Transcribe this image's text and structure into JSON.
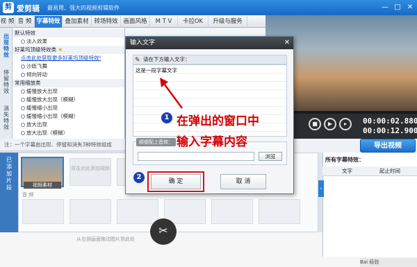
{
  "app": {
    "name": "爱剪辑",
    "slogan": "最易用、强大的视频剪辑软件",
    "window_buttons": [
      "—",
      "□",
      "✕"
    ]
  },
  "tabs": [
    {
      "label": "视 频"
    },
    {
      "label": "音 频"
    },
    {
      "label": "字幕特效",
      "active": true
    },
    {
      "label": "叠加素材"
    },
    {
      "label": "转场特效"
    },
    {
      "label": "画面风格"
    },
    {
      "label": "M T V"
    },
    {
      "label": "卡拉OK"
    },
    {
      "label": "升级与服务"
    }
  ],
  "vertical_tabs": [
    {
      "label": "出现特效"
    },
    {
      "label": "停留特效"
    },
    {
      "label": "消失特效"
    }
  ],
  "effects": {
    "group1": "默认特效",
    "item_fade": "淡入效果",
    "group2": "好莱坞顶级特效类",
    "promo_link": "点击此处获取更多好莱坞顶级特效!",
    "item_sand": "沙砾飞舞",
    "item_rotate": "倾向转动",
    "group3": "常用缩放类",
    "items_zoom": [
      "缓慢放大出现",
      "缓慢放大出现（模糊）",
      "缓慢缩小出现",
      "缓慢缩小出现（模糊）",
      "放大出现",
      "放大出现（模糊）"
    ]
  },
  "status_hint": "注：一个字幕由出现、停留和消失3种特效组成",
  "preview": {
    "timecode_current": "00:00:02.880",
    "timecode_total": "00:00:12.900",
    "export_label": "导出视频"
  },
  "timeline": {
    "side_label": "已添加片段",
    "clip1_label": "视频素材",
    "placeholder_clip": "双击此处添加视频",
    "audio_label": "音 频",
    "drag_hint": "从右侧画面拖动图片到此处"
  },
  "subtitle_list": {
    "heading": "所有字幕特效：",
    "col_text": "文字",
    "col_time": "起止时间"
  },
  "dialog": {
    "title": "输入文字",
    "close": "✕",
    "prompt": "请在下方输入文字：",
    "text_value": "这是一段字幕文字",
    "sound_label": "顺便配上音效：",
    "browse_label": "浏览",
    "ok_label": "确 定",
    "cancel_label": "取 消"
  },
  "annotations": {
    "step1": "1",
    "step2": "2",
    "line1": "在弹出的窗口中",
    "line2": "输入字幕内容",
    "accent": "#d80000"
  },
  "watermark": "Bai 经验"
}
